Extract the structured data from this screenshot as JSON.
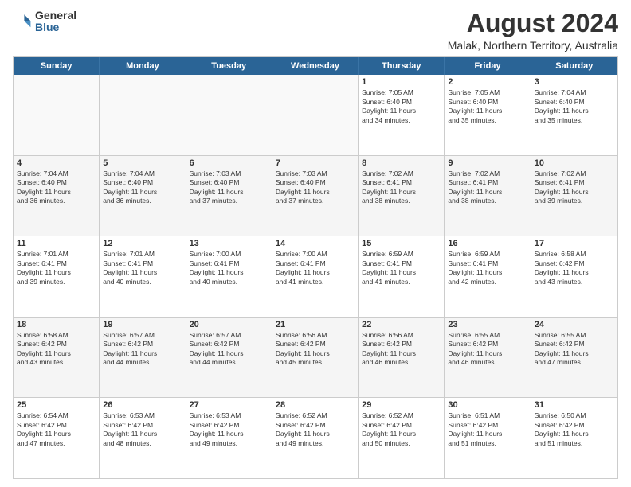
{
  "logo": {
    "general": "General",
    "blue": "Blue"
  },
  "header": {
    "title": "August 2024",
    "subtitle": "Malak, Northern Territory, Australia"
  },
  "weekdays": [
    "Sunday",
    "Monday",
    "Tuesday",
    "Wednesday",
    "Thursday",
    "Friday",
    "Saturday"
  ],
  "weeks": [
    [
      {
        "day": "",
        "content": ""
      },
      {
        "day": "",
        "content": ""
      },
      {
        "day": "",
        "content": ""
      },
      {
        "day": "",
        "content": ""
      },
      {
        "day": "1",
        "content": "Sunrise: 7:05 AM\nSunset: 6:40 PM\nDaylight: 11 hours\nand 34 minutes."
      },
      {
        "day": "2",
        "content": "Sunrise: 7:05 AM\nSunset: 6:40 PM\nDaylight: 11 hours\nand 35 minutes."
      },
      {
        "day": "3",
        "content": "Sunrise: 7:04 AM\nSunset: 6:40 PM\nDaylight: 11 hours\nand 35 minutes."
      }
    ],
    [
      {
        "day": "4",
        "content": "Sunrise: 7:04 AM\nSunset: 6:40 PM\nDaylight: 11 hours\nand 36 minutes."
      },
      {
        "day": "5",
        "content": "Sunrise: 7:04 AM\nSunset: 6:40 PM\nDaylight: 11 hours\nand 36 minutes."
      },
      {
        "day": "6",
        "content": "Sunrise: 7:03 AM\nSunset: 6:40 PM\nDaylight: 11 hours\nand 37 minutes."
      },
      {
        "day": "7",
        "content": "Sunrise: 7:03 AM\nSunset: 6:40 PM\nDaylight: 11 hours\nand 37 minutes."
      },
      {
        "day": "8",
        "content": "Sunrise: 7:02 AM\nSunset: 6:41 PM\nDaylight: 11 hours\nand 38 minutes."
      },
      {
        "day": "9",
        "content": "Sunrise: 7:02 AM\nSunset: 6:41 PM\nDaylight: 11 hours\nand 38 minutes."
      },
      {
        "day": "10",
        "content": "Sunrise: 7:02 AM\nSunset: 6:41 PM\nDaylight: 11 hours\nand 39 minutes."
      }
    ],
    [
      {
        "day": "11",
        "content": "Sunrise: 7:01 AM\nSunset: 6:41 PM\nDaylight: 11 hours\nand 39 minutes."
      },
      {
        "day": "12",
        "content": "Sunrise: 7:01 AM\nSunset: 6:41 PM\nDaylight: 11 hours\nand 40 minutes."
      },
      {
        "day": "13",
        "content": "Sunrise: 7:00 AM\nSunset: 6:41 PM\nDaylight: 11 hours\nand 40 minutes."
      },
      {
        "day": "14",
        "content": "Sunrise: 7:00 AM\nSunset: 6:41 PM\nDaylight: 11 hours\nand 41 minutes."
      },
      {
        "day": "15",
        "content": "Sunrise: 6:59 AM\nSunset: 6:41 PM\nDaylight: 11 hours\nand 41 minutes."
      },
      {
        "day": "16",
        "content": "Sunrise: 6:59 AM\nSunset: 6:41 PM\nDaylight: 11 hours\nand 42 minutes."
      },
      {
        "day": "17",
        "content": "Sunrise: 6:58 AM\nSunset: 6:42 PM\nDaylight: 11 hours\nand 43 minutes."
      }
    ],
    [
      {
        "day": "18",
        "content": "Sunrise: 6:58 AM\nSunset: 6:42 PM\nDaylight: 11 hours\nand 43 minutes."
      },
      {
        "day": "19",
        "content": "Sunrise: 6:57 AM\nSunset: 6:42 PM\nDaylight: 11 hours\nand 44 minutes."
      },
      {
        "day": "20",
        "content": "Sunrise: 6:57 AM\nSunset: 6:42 PM\nDaylight: 11 hours\nand 44 minutes."
      },
      {
        "day": "21",
        "content": "Sunrise: 6:56 AM\nSunset: 6:42 PM\nDaylight: 11 hours\nand 45 minutes."
      },
      {
        "day": "22",
        "content": "Sunrise: 6:56 AM\nSunset: 6:42 PM\nDaylight: 11 hours\nand 46 minutes."
      },
      {
        "day": "23",
        "content": "Sunrise: 6:55 AM\nSunset: 6:42 PM\nDaylight: 11 hours\nand 46 minutes."
      },
      {
        "day": "24",
        "content": "Sunrise: 6:55 AM\nSunset: 6:42 PM\nDaylight: 11 hours\nand 47 minutes."
      }
    ],
    [
      {
        "day": "25",
        "content": "Sunrise: 6:54 AM\nSunset: 6:42 PM\nDaylight: 11 hours\nand 47 minutes."
      },
      {
        "day": "26",
        "content": "Sunrise: 6:53 AM\nSunset: 6:42 PM\nDaylight: 11 hours\nand 48 minutes."
      },
      {
        "day": "27",
        "content": "Sunrise: 6:53 AM\nSunset: 6:42 PM\nDaylight: 11 hours\nand 49 minutes."
      },
      {
        "day": "28",
        "content": "Sunrise: 6:52 AM\nSunset: 6:42 PM\nDaylight: 11 hours\nand 49 minutes."
      },
      {
        "day": "29",
        "content": "Sunrise: 6:52 AM\nSunset: 6:42 PM\nDaylight: 11 hours\nand 50 minutes."
      },
      {
        "day": "30",
        "content": "Sunrise: 6:51 AM\nSunset: 6:42 PM\nDaylight: 11 hours\nand 51 minutes."
      },
      {
        "day": "31",
        "content": "Sunrise: 6:50 AM\nSunset: 6:42 PM\nDaylight: 11 hours\nand 51 minutes."
      }
    ]
  ]
}
